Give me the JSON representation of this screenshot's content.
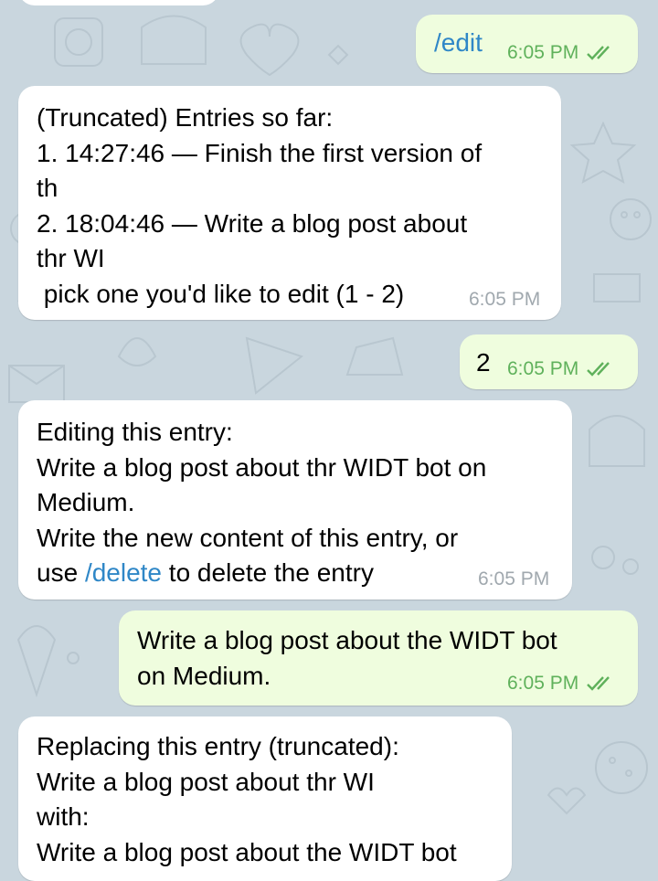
{
  "messages": [
    {
      "dir": "out",
      "text": "/edit",
      "time": "6:05 PM",
      "is_command": true
    },
    {
      "dir": "in",
      "lines": [
        "(Truncated) Entries so far:",
        "1. 14:27:46 — Finish the first version of",
        "th",
        "2. 18:04:46 — Write a blog post about",
        "thr WI",
        " pick one you'd like to edit (1 - 2)"
      ],
      "time": "6:05 PM"
    },
    {
      "dir": "out",
      "text": "2",
      "time": "6:05 PM"
    },
    {
      "dir": "in",
      "lines": [
        "Editing this entry:",
        "Write a blog post about thr WIDT bot on",
        "Medium.",
        "Write the new content of this entry, or"
      ],
      "last_line_pre": "use ",
      "last_line_cmd": "/delete",
      "last_line_post": " to delete the entry",
      "time": "6:05 PM"
    },
    {
      "dir": "out",
      "lines": [
        "Write a blog post about the WIDT bot",
        "on Medium."
      ],
      "time": "6:05 PM"
    },
    {
      "dir": "in",
      "lines": [
        "Replacing this entry (truncated):",
        "Write a blog post about thr WI",
        "with:",
        "Write a blog post about the WIDT bot"
      ]
    }
  ],
  "colors": {
    "background": "#c9d6de",
    "incoming_bubble": "#ffffff",
    "outgoing_bubble": "#effdde",
    "outgoing_meta": "#5fb15b",
    "incoming_meta": "#a0a8ae",
    "command_link": "#2f87c7"
  },
  "icons": {
    "read_receipt": "double-check-icon"
  }
}
